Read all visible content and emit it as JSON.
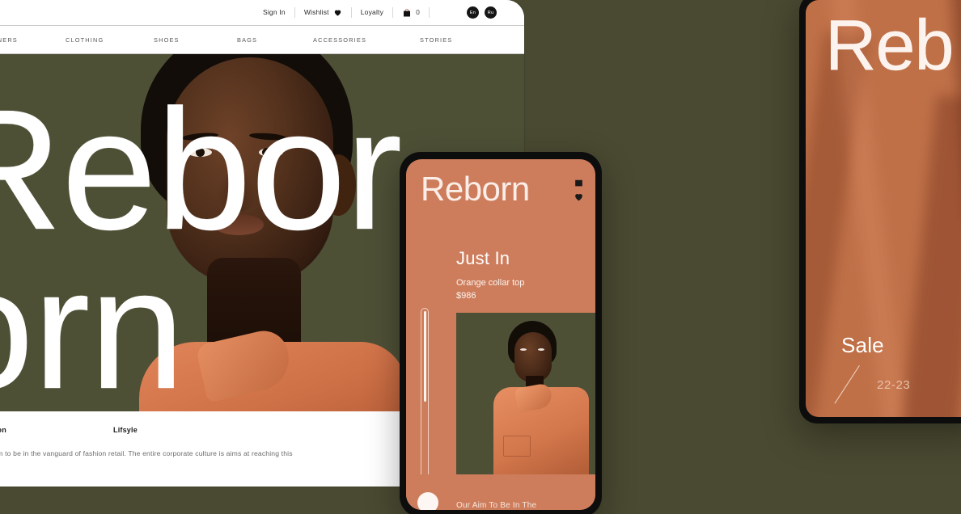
{
  "brand": "Reborn",
  "colors": {
    "olive_bg": "#4a4a32",
    "hero_olive": "#4e5036",
    "orange": "#cd7d5c",
    "tablet_orange": "#bf7047",
    "white": "#ffffff",
    "dark": "#0d0d0d"
  },
  "browser": {
    "utility": {
      "sign_in": "Sign In",
      "wishlist": "Wishlist",
      "loyalty": "Loyalty",
      "cart_count": "0",
      "wishlist_icon": "heart-icon",
      "cart_icon": "shopping-bag-icon"
    },
    "languages": [
      {
        "code": "En"
      },
      {
        "code": "Ru"
      }
    ],
    "nav": [
      {
        "label": "DESIGNERS"
      },
      {
        "label": "CLOTHING"
      },
      {
        "label": "SHOES"
      },
      {
        "label": "BAGS"
      },
      {
        "label": "ACCESSORIES"
      },
      {
        "label": "STORIES"
      }
    ],
    "hero": {
      "line1": "Rebor",
      "line2": "orn"
    },
    "info": {
      "col1_heading": "Fashion",
      "col2_heading": "Lifsyle",
      "body": "Our aim to be in the vanguard of fashion retail. The entire corporate culture is aims at reaching this goal."
    }
  },
  "phone": {
    "brand": "Reborn",
    "cart_icon": "shopping-bag-icon",
    "wishlist_icon": "heart-icon",
    "section_title": "Just In",
    "product_name": "Orange collar top",
    "product_price": "$986",
    "footer_text": "Our Aim To Be In The"
  },
  "tablet": {
    "brand": "Reb",
    "sale_label": "Sale",
    "season": "22-23"
  }
}
